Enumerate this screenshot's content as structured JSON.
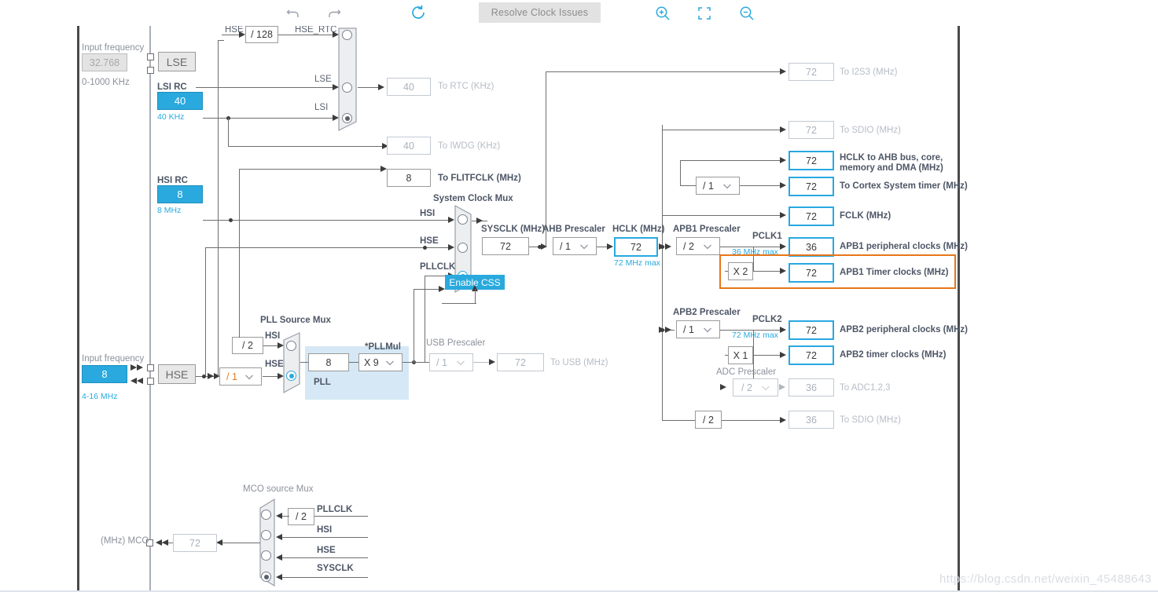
{
  "toolbar": {
    "undo": "undo-icon",
    "redo": "redo-icon",
    "reset": "reset-icon",
    "resolve_label": "Resolve Clock Issues",
    "zoom_in": "zoom-in-icon",
    "fit": "fit-screen-icon",
    "zoom_out": "zoom-out-icon"
  },
  "lse": {
    "input_frequency_label": "Input frequency",
    "input_frequency_value": "32.768",
    "range": "0-1000 KHz",
    "device_label": "LSE"
  },
  "lsi": {
    "label": "LSI RC",
    "value": "40",
    "unit": "40 KHz"
  },
  "hsi": {
    "label": "HSI RC",
    "value": "8",
    "unit": "8 MHz"
  },
  "hse": {
    "input_frequency_label": "Input frequency",
    "input_frequency_value": "8",
    "range": "4-16 MHz",
    "device_label": "HSE",
    "divider": "/ 1"
  },
  "rtc_mux": {
    "hse_label": "HSE",
    "hse_div": "/ 128",
    "hse_rtc_label": "HSE_RTC",
    "lse_label": "LSE",
    "lsi_label": "LSI",
    "selected": "LSI"
  },
  "outputs": {
    "rtc": {
      "value": "40",
      "label": "To RTC (KHz)"
    },
    "iwdg": {
      "value": "40",
      "label": "To IWDG (KHz)"
    },
    "flitfclk": {
      "value": "8",
      "label": "To FLITFCLK (MHz)"
    },
    "i2s3": {
      "value": "72",
      "label": "To I2S3 (MHz)"
    },
    "sdio_top": {
      "value": "72",
      "label": "To SDIO (MHz)"
    },
    "usb": {
      "value": "72",
      "label": "To USB (MHz)"
    },
    "adc": {
      "value": "36",
      "label": "To ADC1,2,3"
    },
    "sdio_bottom": {
      "value": "36",
      "label": "To SDIO (MHz)"
    }
  },
  "sysclk_mux": {
    "title": "System Clock Mux",
    "inputs": [
      "HSI",
      "HSE",
      "PLLCLK"
    ],
    "selected": "PLLCLK",
    "css_button": "Enable CSS"
  },
  "pll_source_mux": {
    "title": "PLL Source Mux",
    "hsi_div": "/ 2",
    "hsi_label": "HSI",
    "hse_label": "HSE",
    "selected": "HSE"
  },
  "pll": {
    "panel_label": "PLL",
    "input_value": "8",
    "pllmul_label": "*PLLMul",
    "pllmul_value": "X 9"
  },
  "usb_prescaler": {
    "label": "USB Prescaler",
    "value": "/ 1"
  },
  "sysclk": {
    "label": "SYSCLK (MHz)",
    "value": "72"
  },
  "ahb_prescaler": {
    "label": "AHB Prescaler",
    "value": "/ 1"
  },
  "hclk": {
    "label": "HCLK (MHz)",
    "value": "72",
    "max": "72 MHz max"
  },
  "ahb_outputs": [
    {
      "value": "72",
      "label": "HCLK to AHB bus, core,\nmemory and DMA (MHz)"
    },
    {
      "value": "72",
      "label": "To Cortex System timer (MHz)",
      "prescaler": "/ 1"
    },
    {
      "value": "72",
      "label": "FCLK (MHz)"
    }
  ],
  "cortex_prescaler": "/ 1",
  "apb1": {
    "prescaler_label": "APB1 Prescaler",
    "prescaler_value": "/ 2",
    "pclk_label": "PCLK1",
    "max": "36 MHz max",
    "peripheral_value": "36",
    "peripheral_label": "APB1 peripheral clocks (MHz)",
    "timer_mult": "X 2",
    "timer_value": "72",
    "timer_label": "APB1 Timer clocks (MHz)"
  },
  "apb2": {
    "prescaler_label": "APB2 Prescaler",
    "prescaler_value": "/ 1",
    "pclk_label": "PCLK2",
    "max": "72 MHz max",
    "peripheral_value": "72",
    "peripheral_label": "APB2 peripheral clocks (MHz)",
    "timer_mult": "X 1",
    "timer_value": "72",
    "timer_label": "APB2 timer clocks (MHz)",
    "adc_prescaler_label": "ADC Prescaler",
    "adc_prescaler_value": "/ 2"
  },
  "sdio_divider": "/ 2",
  "mco": {
    "title": "MCO source Mux",
    "output_label": "(MHz) MCO",
    "output_value": "72",
    "pllclk_div": "/ 2",
    "inputs": [
      "PLLCLK",
      "HSI",
      "HSE",
      "SYSCLK"
    ],
    "selected": "SYSCLK"
  },
  "watermark": "https://blog.csdn.net/weixin_45488643",
  "colors": {
    "accent_blue": "#29a9dd",
    "highlight_orange": "#e8761a",
    "pll_panel": "#d6e8f5",
    "wire": "#6e6e6e"
  }
}
